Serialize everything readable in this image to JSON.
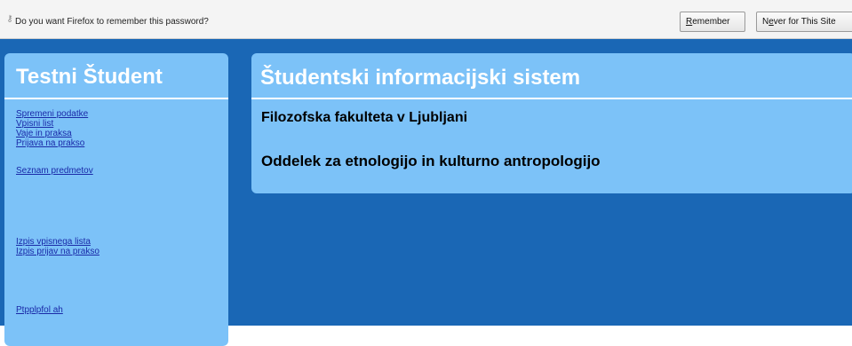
{
  "notification": {
    "icon": "key-icon",
    "message": "Do you want Firefox to remember this password?",
    "remember_button": {
      "first_letter": "R",
      "rest": "emember"
    },
    "never_button": {
      "prefix": "N",
      "underlined": "e",
      "rest": "ver for This Site"
    }
  },
  "sidebar": {
    "title": "Testni Študent",
    "links_group1": [
      "Spremeni podatke",
      "Vpisni list",
      "Vaje in praksa",
      "Prijava na prakso"
    ],
    "link_subjects": "Seznam predmetov",
    "links_group2": [
      "Izpis vpisnega lista",
      "Izpis prijav na prakso"
    ],
    "link_bottom": "Ptpplpfol ah"
  },
  "main": {
    "title": "Študentski informacijski sistem",
    "faculty": "Filozofska fakulteta v Ljubljani",
    "department": "Oddelek za etnologijo in kulturno antropologijo"
  },
  "colors": {
    "page_background": "#1a67b5",
    "panel_background": "#7cc2f8",
    "link": "#1a2aa8"
  }
}
